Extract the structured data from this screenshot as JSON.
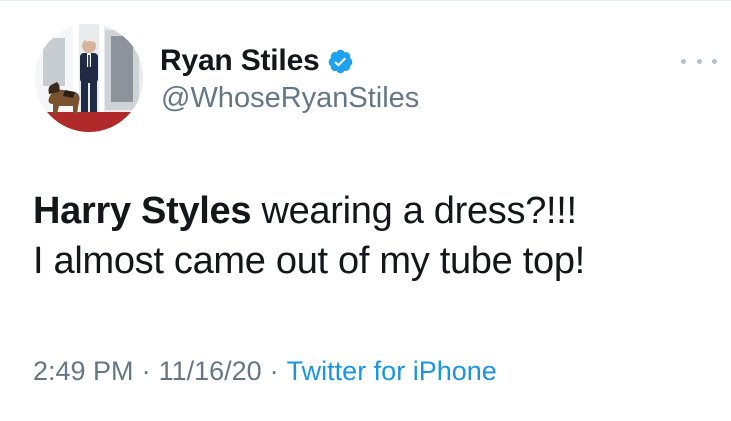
{
  "tweet": {
    "author": {
      "display_name": "Ryan Stiles",
      "handle": "@WhoseRyanStiles",
      "verified": true
    },
    "text": {
      "line1_bold": "Harry Styles",
      "line1_rest": " wearing a dress?!!!",
      "line2": "I almost came out of my tube top!"
    },
    "meta": {
      "time": "2:49 PM",
      "separator": "·",
      "date": "11/16/20",
      "source": "Twitter for iPhone"
    },
    "icons": {
      "verified": "verified-badge-icon",
      "more": "more-options-icon"
    },
    "colors": {
      "text": "#14171a",
      "secondary": "#657786",
      "link": "#1b95e0",
      "verified": "#1da1f2"
    }
  }
}
